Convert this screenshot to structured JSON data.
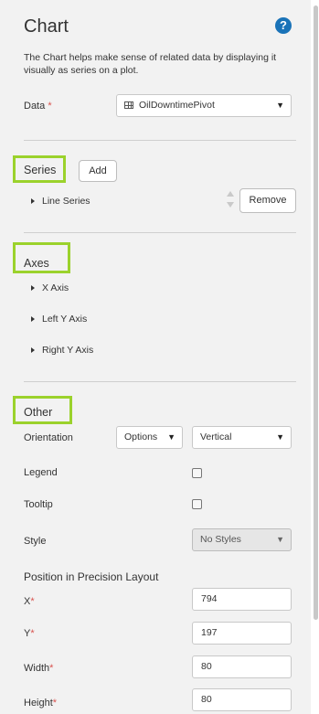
{
  "header": {
    "title": "Chart",
    "help_icon": "question-circle-icon",
    "description": "The Chart helps make sense of related data by displaying it visually as series on a plot."
  },
  "data_field": {
    "label": "Data",
    "required_mark": "*",
    "value": "OilDowntimePivot",
    "icon": "table-grid-icon"
  },
  "series": {
    "title": "Series",
    "add_label": "Add",
    "items": [
      {
        "label": "Line Series"
      }
    ],
    "remove_label": "Remove"
  },
  "axes": {
    "title": "Axes",
    "items": [
      {
        "label": "X Axis"
      },
      {
        "label": "Left Y Axis"
      },
      {
        "label": "Right Y Axis"
      }
    ]
  },
  "other": {
    "title": "Other",
    "orientation": {
      "label": "Orientation",
      "mode": "Options",
      "value": "Vertical"
    },
    "legend": {
      "label": "Legend",
      "checked": false
    },
    "tooltip": {
      "label": "Tooltip",
      "checked": false
    },
    "style": {
      "label": "Style",
      "value": "No Styles"
    }
  },
  "precision_layout": {
    "title": "Position in Precision Layout",
    "required_mark": "*",
    "x": {
      "label": "X",
      "value": "794"
    },
    "y": {
      "label": "Y",
      "value": "197"
    },
    "width": {
      "label": "Width",
      "value": "80"
    },
    "height": {
      "label": "Height",
      "value": "80"
    }
  },
  "colors": {
    "panel_bg": "#f2f2f2",
    "highlight_box": "#9bd22c",
    "required": "#d9534f",
    "help_icon": "#1a73b8"
  }
}
